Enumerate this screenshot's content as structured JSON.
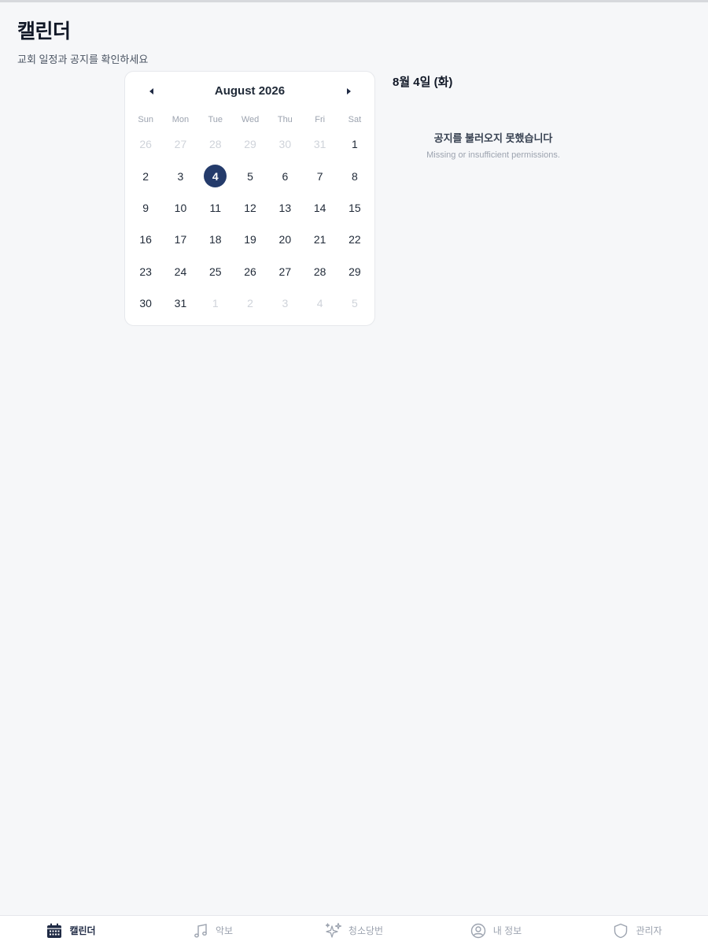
{
  "header": {
    "title": "캘린더",
    "subtitle": "교회 일정과 공지를 확인하세요"
  },
  "calendar": {
    "month_label": "August 2026",
    "weekdays": [
      "Sun",
      "Mon",
      "Tue",
      "Wed",
      "Thu",
      "Fri",
      "Sat"
    ],
    "days": [
      {
        "label": "26",
        "muted": true
      },
      {
        "label": "27",
        "muted": true
      },
      {
        "label": "28",
        "muted": true
      },
      {
        "label": "29",
        "muted": true
      },
      {
        "label": "30",
        "muted": true
      },
      {
        "label": "31",
        "muted": true
      },
      {
        "label": "1"
      },
      {
        "label": "2"
      },
      {
        "label": "3"
      },
      {
        "label": "4",
        "selected": true
      },
      {
        "label": "5"
      },
      {
        "label": "6"
      },
      {
        "label": "7"
      },
      {
        "label": "8"
      },
      {
        "label": "9"
      },
      {
        "label": "10"
      },
      {
        "label": "11"
      },
      {
        "label": "12"
      },
      {
        "label": "13"
      },
      {
        "label": "14"
      },
      {
        "label": "15"
      },
      {
        "label": "16"
      },
      {
        "label": "17"
      },
      {
        "label": "18"
      },
      {
        "label": "19"
      },
      {
        "label": "20"
      },
      {
        "label": "21"
      },
      {
        "label": "22"
      },
      {
        "label": "23"
      },
      {
        "label": "24"
      },
      {
        "label": "25"
      },
      {
        "label": "26"
      },
      {
        "label": "27"
      },
      {
        "label": "28"
      },
      {
        "label": "29"
      },
      {
        "label": "30"
      },
      {
        "label": "31"
      },
      {
        "label": "1",
        "muted": true
      },
      {
        "label": "2",
        "muted": true
      },
      {
        "label": "3",
        "muted": true
      },
      {
        "label": "4",
        "muted": true
      },
      {
        "label": "5",
        "muted": true
      }
    ],
    "prev_icon": "chevron-left-icon",
    "next_icon": "chevron-right-icon",
    "accent_color": "#243b6b"
  },
  "detail": {
    "selected_date": "8월 4일 (화)",
    "notice_title": "공지를 불러오지 못했습니다",
    "notice_message": "Missing or insufficient permissions."
  },
  "bottom_nav": {
    "items": [
      {
        "label": "캘린더",
        "icon": "calendar-icon",
        "active": true
      },
      {
        "label": "악보",
        "icon": "music-note-icon"
      },
      {
        "label": "청소당번",
        "icon": "sparkles-icon"
      },
      {
        "label": "내 정보",
        "icon": "user-circle-icon"
      },
      {
        "label": "관리자",
        "icon": "shield-icon"
      }
    ]
  }
}
